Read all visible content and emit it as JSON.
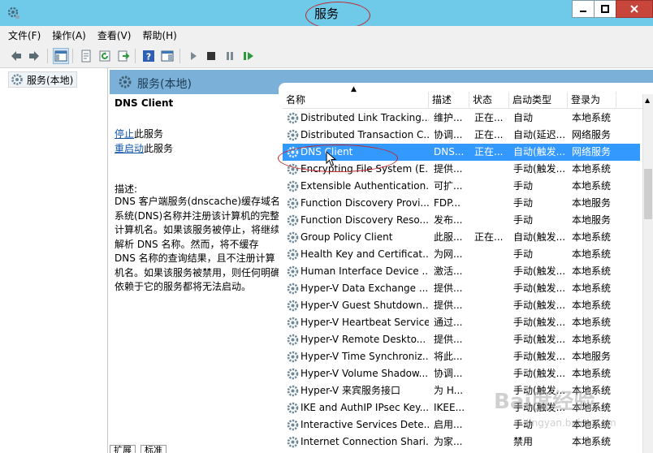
{
  "window": {
    "title": "服务"
  },
  "menu": [
    "文件(F)",
    "操作(A)",
    "查看(V)",
    "帮助(H)"
  ],
  "tree": {
    "label": "服务(本地)"
  },
  "pane": {
    "title": "服务(本地)"
  },
  "detail": {
    "service_name": "DNS Client",
    "stop_link": "停止",
    "stop_suffix": "此服务",
    "restart_link": "重启动",
    "restart_suffix": "此服务",
    "desc_label": "描述:",
    "desc_text": "DNS 客户端服务(dnscache)缓存域名系统(DNS)名称并注册该计算机的完整计算机名。如果该服务被停止，将继续解析 DNS 名称。然而，将不缓存 DNS 名称的查询结果，且不注册计算机名。如果该服务被禁用，则任何明确依赖于它的服务都将无法启动。"
  },
  "columns": [
    "名称",
    "描述",
    "状态",
    "启动类型",
    "登录为"
  ],
  "services": [
    {
      "name": "Distributed Link Tracking...",
      "desc": "维护...",
      "status": "正在...",
      "start": "自动",
      "logon": "本地系统"
    },
    {
      "name": "Distributed Transaction C...",
      "desc": "协调...",
      "status": "正在...",
      "start": "自动(延迟...",
      "logon": "网络服务"
    },
    {
      "name": "DNS Client",
      "desc": "DNS...",
      "status": "正在...",
      "start": "自动(触发...",
      "logon": "网络服务",
      "selected": true
    },
    {
      "name": "Encrypting File System (E...",
      "desc": "提供...",
      "status": "",
      "start": "手动(触发...",
      "logon": "本地系统"
    },
    {
      "name": "Extensible Authentication...",
      "desc": "可扩...",
      "status": "",
      "start": "手动",
      "logon": "本地系统"
    },
    {
      "name": "Function Discovery Provi...",
      "desc": "FDP...",
      "status": "",
      "start": "手动",
      "logon": "本地服务"
    },
    {
      "name": "Function Discovery Reso...",
      "desc": "发布...",
      "status": "",
      "start": "手动",
      "logon": "本地服务"
    },
    {
      "name": "Group Policy Client",
      "desc": "此服...",
      "status": "正在...",
      "start": "自动(触发...",
      "logon": "本地系统"
    },
    {
      "name": "Health Key and Certificat...",
      "desc": "为网...",
      "status": "",
      "start": "手动",
      "logon": "本地系统"
    },
    {
      "name": "Human Interface Device ...",
      "desc": "激活...",
      "status": "",
      "start": "手动(触发...",
      "logon": "本地系统"
    },
    {
      "name": "Hyper-V Data Exchange ...",
      "desc": "提供...",
      "status": "",
      "start": "手动(触发...",
      "logon": "本地系统"
    },
    {
      "name": "Hyper-V Guest Shutdown...",
      "desc": "提供...",
      "status": "",
      "start": "手动(触发...",
      "logon": "本地系统"
    },
    {
      "name": "Hyper-V Heartbeat Service",
      "desc": "通过...",
      "status": "",
      "start": "手动(触发...",
      "logon": "本地系统"
    },
    {
      "name": "Hyper-V Remote Deskto...",
      "desc": "提供...",
      "status": "",
      "start": "手动(触发...",
      "logon": "本地系统"
    },
    {
      "name": "Hyper-V Time Synchroniz...",
      "desc": "将此...",
      "status": "",
      "start": "手动(触发...",
      "logon": "本地服务"
    },
    {
      "name": "Hyper-V Volume Shadow...",
      "desc": "协调...",
      "status": "",
      "start": "手动(触发...",
      "logon": "本地系统"
    },
    {
      "name": "Hyper-V 来宾服务接口",
      "desc": "为 H...",
      "status": "",
      "start": "手动(触发...",
      "logon": "本地系统"
    },
    {
      "name": "IKE and AuthIP IPsec Key...",
      "desc": "IKEE...",
      "status": "",
      "start": "手动(触发...",
      "logon": "本地系统"
    },
    {
      "name": "Interactive Services Dete...",
      "desc": "启用...",
      "status": "",
      "start": "手动",
      "logon": "本地系统"
    },
    {
      "name": "Internet Connection Shari...",
      "desc": "为家...",
      "status": "",
      "start": "禁用",
      "logon": "本地系统"
    }
  ],
  "tabs": [
    "扩展",
    "标准"
  ],
  "watermark": {
    "brand": "Bai度经验",
    "url": "jingyan.baidu.com"
  },
  "colors": {
    "titlebar": "#6fc9e8",
    "pane_header": "#7bb1d8",
    "selection": "#3399ff",
    "link": "#1155aa",
    "annotation": "#c0282d"
  },
  "icons": [
    "services-app-icon",
    "back-icon",
    "forward-icon",
    "console-tree-icon",
    "properties-icon",
    "refresh-icon",
    "export-icon",
    "help-icon",
    "action-pane-icon",
    "play-icon",
    "stop-icon",
    "pause-icon",
    "restart-icon",
    "gear-icon"
  ]
}
